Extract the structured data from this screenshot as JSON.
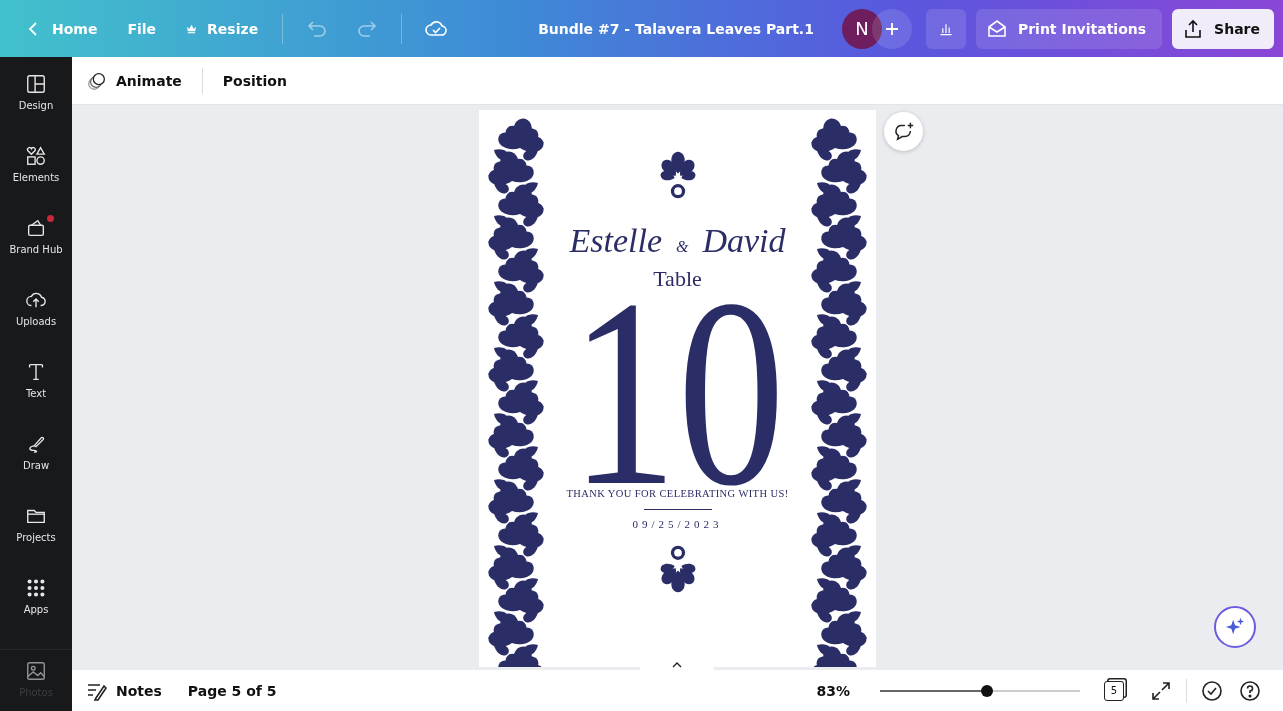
{
  "topbar": {
    "nav": [
      {
        "label": "Home"
      },
      {
        "label": "File"
      },
      {
        "label": "Resize"
      }
    ],
    "title": "Bundle #7 - Talavera Leaves Part.1",
    "avatar": "N",
    "print_button": "Print Invitations",
    "share_button": "Share"
  },
  "sidebar": {
    "items": [
      {
        "label": "Design",
        "notification": false
      },
      {
        "label": "Elements",
        "notification": false
      },
      {
        "label": "Brand Hub",
        "notification": true
      },
      {
        "label": "Uploads",
        "notification": false
      },
      {
        "label": "Text",
        "notification": false
      },
      {
        "label": "Draw",
        "notification": false
      },
      {
        "label": "Projects",
        "notification": false
      },
      {
        "label": "Apps",
        "notification": false
      },
      {
        "label": "Photos",
        "notification": false,
        "disabled": true
      }
    ]
  },
  "toolbar": {
    "items": [
      {
        "label": "Animate"
      },
      {
        "label": "Position"
      }
    ]
  },
  "design": {
    "name_1": "Estelle",
    "ampersand": "&",
    "name_2": "David",
    "heading": "Table",
    "number": "10",
    "message": "THANK YOU FOR CELEBRATING WITH US!",
    "date": "09/25/2023"
  },
  "bottom_bar": {
    "notes": "Notes",
    "page": "Page 5 of 5",
    "zoom": "83%",
    "zoom_slider": {
      "level": 0.535
    },
    "page_count": "5"
  }
}
